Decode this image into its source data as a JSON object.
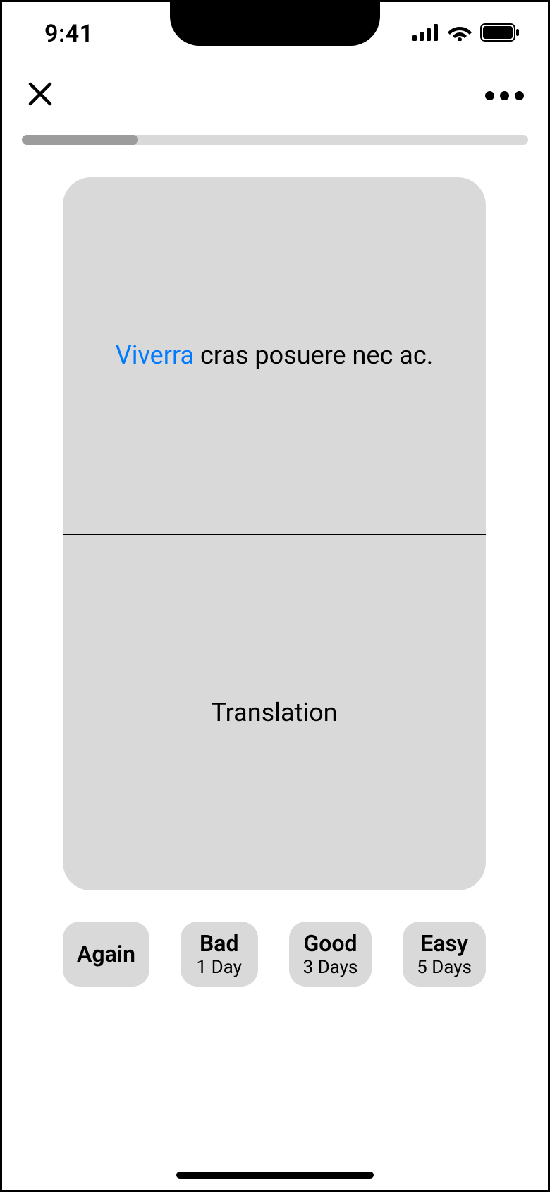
{
  "statusBar": {
    "time": "9:41"
  },
  "progress": {
    "percent": 23
  },
  "card": {
    "highlight": "Viverra",
    "rest": " cras posuere nec ac.",
    "translation": "Translation"
  },
  "buttons": {
    "again": {
      "label": "Again",
      "sublabel": ""
    },
    "bad": {
      "label": "Bad",
      "sublabel": "1 Day"
    },
    "good": {
      "label": "Good",
      "sublabel": "3 Days"
    },
    "easy": {
      "label": "Easy",
      "sublabel": "5 Days"
    }
  }
}
